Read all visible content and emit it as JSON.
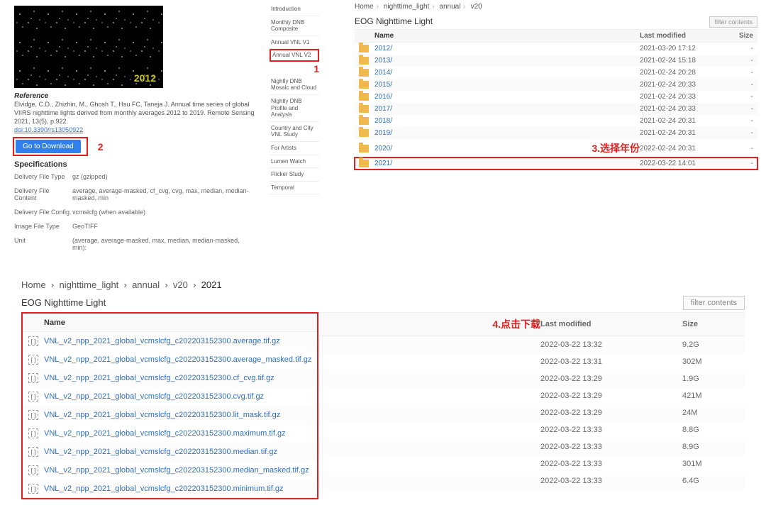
{
  "image_year_label": "2012",
  "reference": {
    "heading": "Reference",
    "text": "Elvidge, C.D., Zhizhin, M., Ghosh T., Hsu FC, Taneja J. Annual time series of global VIIRS nighttime lights derived from monthly averages 2012 to 2019. Remote Sensing 2021, 13(5), p.922.",
    "doi": "doi:10.3390/rs13050922"
  },
  "download_btn": "Go to Download",
  "anno1": "1",
  "anno2": "2",
  "anno3": "3.选择年份",
  "anno4": "4.点击下载",
  "specs_heading": "Specifications",
  "specs": [
    {
      "k": "Delivery File Type",
      "v": "gz (gzipped)"
    },
    {
      "k": "Delivery File Content",
      "v": "average, average-masked, cf_cvg, cvg, max, median, median-masked, min"
    },
    {
      "k": "Delivery File Config.",
      "v": "vcmslcfg (when available)"
    },
    {
      "k": "Image File Type",
      "v": "GeoTIFF"
    },
    {
      "k": "Unit",
      "v": "(average, average-masked, max, median, median-masked, min):"
    }
  ],
  "nav": [
    "Introduction",
    "Monthly DNB Composite",
    "Annual VNL V1",
    "Annual VNL V2",
    "Nightly DNB Mosaic and Cloud",
    "Nightly DNB Profile and Analysis",
    "Country and City VNL Study",
    "For Artists",
    "Lumen Watch",
    "Flicker Study",
    "Temporal"
  ],
  "mini": {
    "crumbs": [
      "Home",
      "nighttime_light",
      "annual",
      "v20"
    ],
    "title": "EOG Nighttime Light",
    "filter": "filter contents",
    "head": {
      "name": "Name",
      "mod": "Last modified",
      "size": "Size"
    },
    "rows": [
      {
        "name": "2012/",
        "mod": "2021-03-20 17:12",
        "size": "-"
      },
      {
        "name": "2013/",
        "mod": "2021-02-24 15:18",
        "size": "-"
      },
      {
        "name": "2014/",
        "mod": "2021-02-24 20:28",
        "size": "-"
      },
      {
        "name": "2015/",
        "mod": "2021-02-24 20:33",
        "size": "-"
      },
      {
        "name": "2016/",
        "mod": "2021-02-24 20:33",
        "size": "-"
      },
      {
        "name": "2017/",
        "mod": "2021-02-24 20:33",
        "size": "-"
      },
      {
        "name": "2018/",
        "mod": "2021-02-24 20:31",
        "size": "-"
      },
      {
        "name": "2019/",
        "mod": "2021-02-24 20:31",
        "size": "-"
      },
      {
        "name": "2020/",
        "mod": "2022-02-24 20:31",
        "size": "-"
      },
      {
        "name": "2021/",
        "mod": "2022-03-22 14:01",
        "size": "-"
      }
    ]
  },
  "big": {
    "crumbs": [
      "Home",
      "nighttime_light",
      "annual",
      "v20",
      "2021"
    ],
    "title": "EOG Nighttime Light",
    "filter": "filter contents",
    "head": {
      "name": "Name",
      "mod": "Last modified",
      "size": "Size"
    },
    "rows": [
      {
        "name": "VNL_v2_npp_2021_global_vcmslcfg_c202203152300.average.tif.gz",
        "mod": "2022-03-22 13:32",
        "size": "9.2G"
      },
      {
        "name": "VNL_v2_npp_2021_global_vcmslcfg_c202203152300.average_masked.tif.gz",
        "mod": "2022-03-22 13:31",
        "size": "302M"
      },
      {
        "name": "VNL_v2_npp_2021_global_vcmslcfg_c202203152300.cf_cvg.tif.gz",
        "mod": "2022-03-22 13:29",
        "size": "1.9G"
      },
      {
        "name": "VNL_v2_npp_2021_global_vcmslcfg_c202203152300.cvg.tif.gz",
        "mod": "2022-03-22 13:29",
        "size": "421M"
      },
      {
        "name": "VNL_v2_npp_2021_global_vcmslcfg_c202203152300.lit_mask.tif.gz",
        "mod": "2022-03-22 13:29",
        "size": "24M"
      },
      {
        "name": "VNL_v2_npp_2021_global_vcmslcfg_c202203152300.maximum.tif.gz",
        "mod": "2022-03-22 13:33",
        "size": "8.8G"
      },
      {
        "name": "VNL_v2_npp_2021_global_vcmslcfg_c202203152300.median.tif.gz",
        "mod": "2022-03-22 13:33",
        "size": "8.9G"
      },
      {
        "name": "VNL_v2_npp_2021_global_vcmslcfg_c202203152300.median_masked.tif.gz",
        "mod": "2022-03-22 13:33",
        "size": "301M"
      },
      {
        "name": "VNL_v2_npp_2021_global_vcmslcfg_c202203152300.minimum.tif.gz",
        "mod": "2022-03-22 13:33",
        "size": "6.4G"
      }
    ]
  }
}
